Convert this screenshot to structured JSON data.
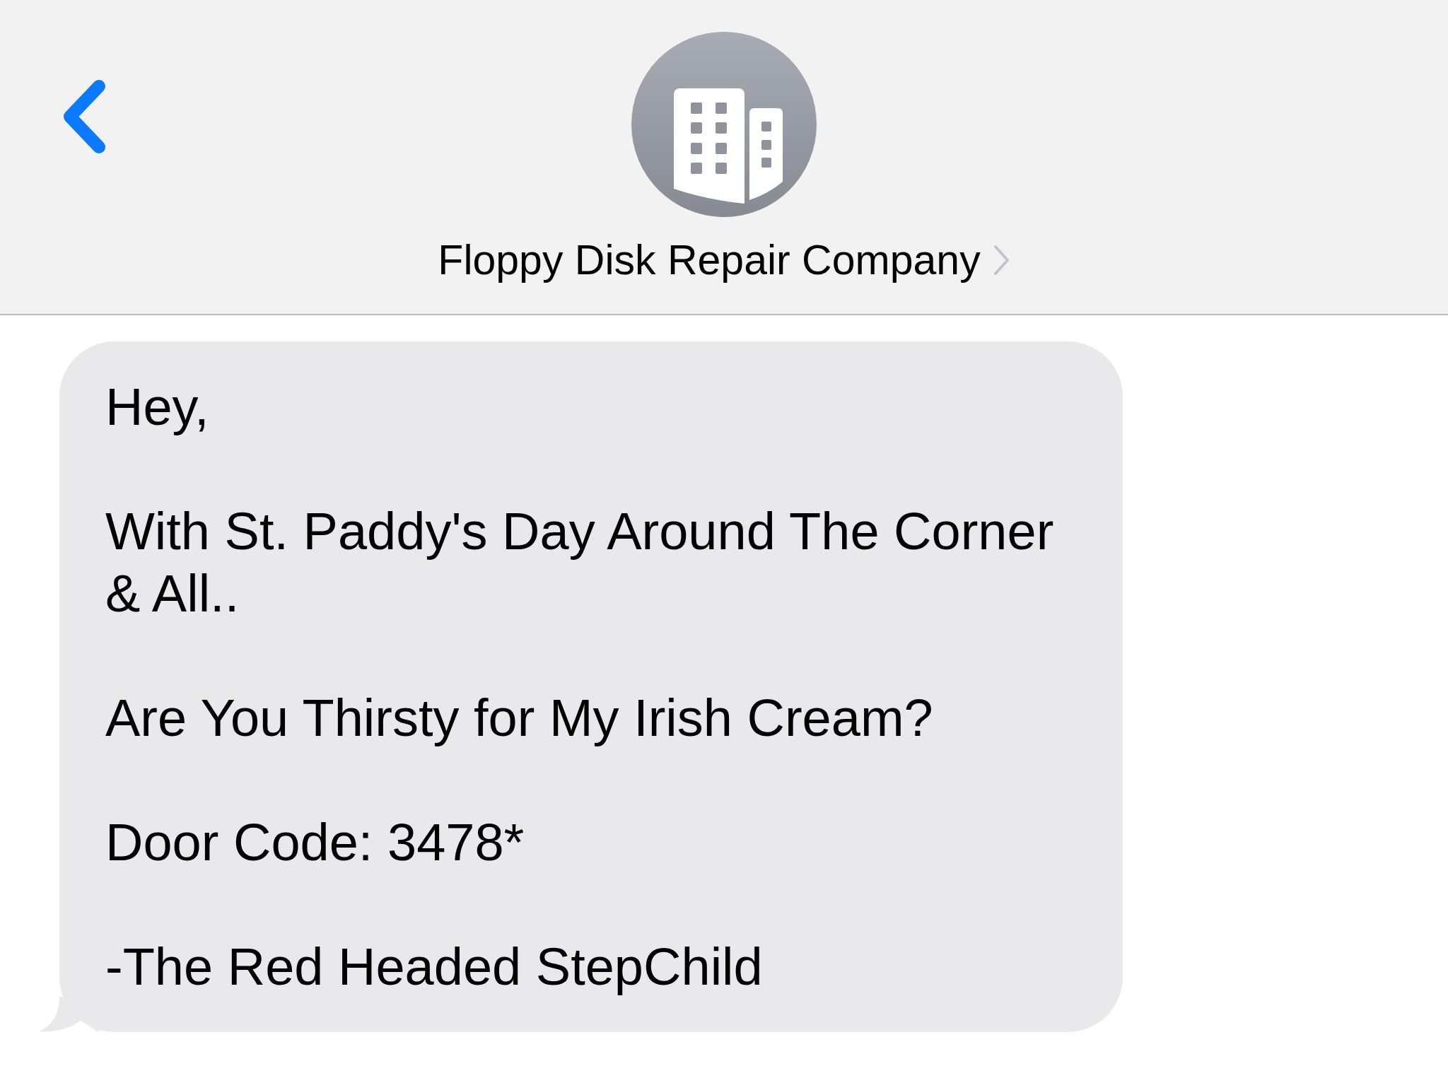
{
  "header": {
    "contact_name": "Floppy Disk Repair Company"
  },
  "messages": [
    {
      "paragraphs": [
        "Hey,",
        "With St. Paddy's Day Around The Corner & All..",
        "Are You Thirsty for My Irish Cream?",
        "Door Code: 3478*",
        "-The Red Headed StepChild"
      ]
    }
  ]
}
